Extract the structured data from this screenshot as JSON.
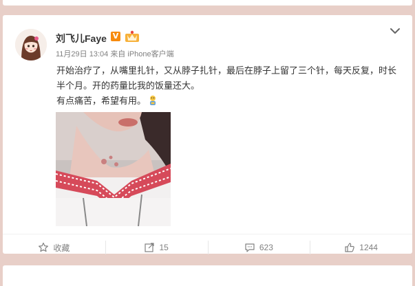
{
  "post": {
    "author": "刘飞儿Faye",
    "verified_badge": "V",
    "timestamp": "11月29日 13:04",
    "source_prefix": "来自",
    "source": "iPhone客户端",
    "text_line1": "开始治疗了，从嘴里扎针，又从脖子扎针，最后在脖子上留了三个针，每天反复，时长半个月。开的药量比我的饭量还大。",
    "text_line2": "有点痛苦，希望有用。"
  },
  "actions": {
    "favorite_label": "收藏",
    "repost_count": "15",
    "comment_count": "623",
    "like_count": "1244"
  },
  "colors": {
    "page_bg": "#e8cfc8",
    "badge_orange": "#f78b0e",
    "meta_gray": "#808080"
  },
  "icons": [
    "chevron-down-icon",
    "member-crown-icon",
    "verified-v-icon",
    "star-icon",
    "repost-icon",
    "comment-icon",
    "like-icon",
    "emoji-icon"
  ]
}
